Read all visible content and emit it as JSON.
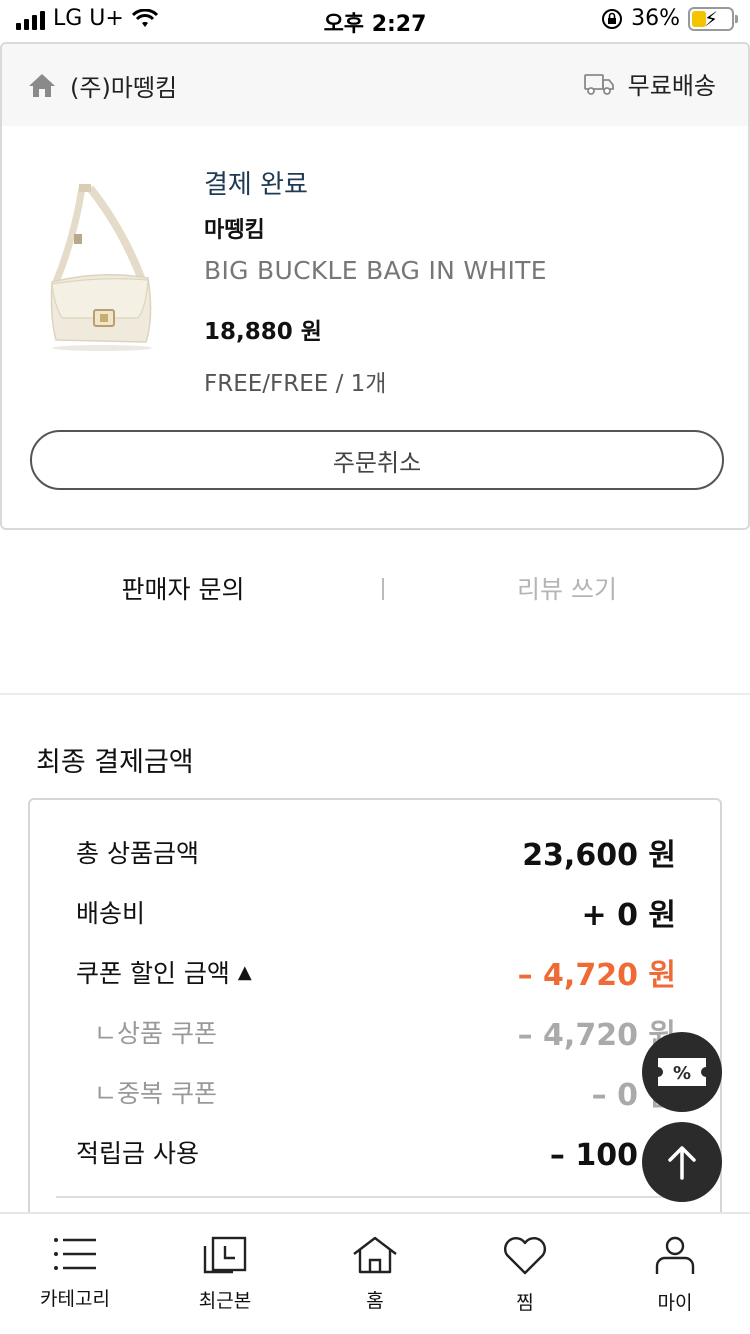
{
  "status_bar": {
    "carrier": "LG U+",
    "time": "오후 2:27",
    "battery": "36%"
  },
  "shop": {
    "name": "(주)마뗑킴",
    "delivery": "무료배송"
  },
  "order": {
    "status": "결제 완료",
    "brand": "마뗑킴",
    "product_name": "BIG BUCKLE BAG IN WHITE",
    "price": "18,880 원",
    "option": "FREE/FREE / 1개",
    "cancel_label": "주문취소"
  },
  "actions": {
    "inquiry": "판매자 문의",
    "review": "리뷰 쓰기"
  },
  "final": {
    "title": "최종 결제금액",
    "rows": [
      {
        "label": "총 상품금액",
        "value": "23,600 원"
      },
      {
        "label": "배송비",
        "value": "+ 0 원"
      },
      {
        "label": "쿠폰 할인 금액",
        "value": "– 4,720 원"
      },
      {
        "label": "ㄴ상품 쿠폰",
        "value": "– 4,720 원"
      },
      {
        "label": "ㄴ중복 쿠폰",
        "value": "– 0 원"
      },
      {
        "label": "적립금 사용",
        "value": "– 100 원"
      }
    ]
  },
  "tabs": [
    {
      "label": "카테고리",
      "icon": "list-icon"
    },
    {
      "label": "최근본",
      "icon": "recent-icon"
    },
    {
      "label": "홈",
      "icon": "home-icon"
    },
    {
      "label": "찜",
      "icon": "heart-icon"
    },
    {
      "label": "마이",
      "icon": "person-icon"
    }
  ],
  "floating": {
    "coupon_symbol": "%"
  },
  "colors": {
    "accent_discount": "#f06a35",
    "status_text": "#1e3a55"
  }
}
